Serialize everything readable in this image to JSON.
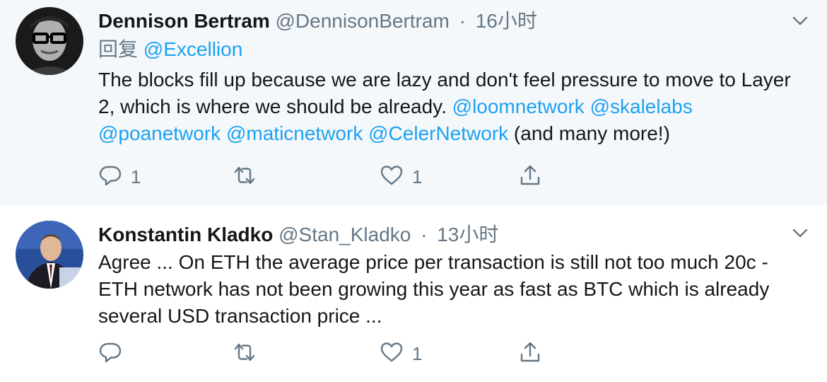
{
  "tweets": [
    {
      "name": "Dennison Bertram",
      "handle": "@DennisonBertram",
      "separator": "·",
      "time": "16小时",
      "reply_label": "回复",
      "reply_to": "@Excellion",
      "body_text_1": "The blocks fill up because we are lazy and don't feel pressure to move to Layer 2, which is where we should be already. ",
      "mentions_line_1": [
        "@loomnetwork",
        "@skalelabs"
      ],
      "mentions_line_2": [
        "@poanetwork",
        "@maticnetwork",
        "@CelerNetwork"
      ],
      "body_text_2": " (and many more!)",
      "reply_count": "1",
      "retweet_count": "",
      "like_count": "1"
    },
    {
      "name": "Konstantin Kladko",
      "handle": "@Stan_Kladko",
      "separator": "·",
      "time": "13小时",
      "body": "Agree ... On ETH the average price per transaction is still not too much 20c - ETH network has not been growing this year as fast as BTC which is already several USD transaction price ...",
      "reply_count": "",
      "retweet_count": "",
      "like_count": "1"
    }
  ],
  "icons": {
    "reply": "reply-icon",
    "retweet": "retweet-icon",
    "like": "heart-icon",
    "share": "share-icon",
    "menu": "chevron-down-icon"
  },
  "colors": {
    "link": "#1da1f2",
    "secondary_text": "#657786",
    "thread_line": "#ccd6dd",
    "highlight_bg": "#f5f8fa"
  }
}
